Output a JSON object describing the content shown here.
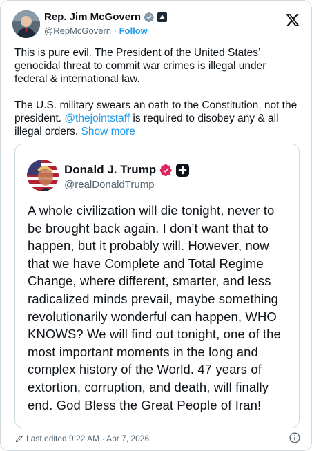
{
  "author": {
    "name": "Rep. Jim McGovern",
    "handle": "@RepMcGovern",
    "separator": "·",
    "follow_label": "Follow"
  },
  "tweet": {
    "paragraph1": "This is pure evil. The President of the United States’ genocidal threat to commit war crimes is illegal under federal & international law.",
    "paragraph2_before": "The U.S. military swears an oath to the Constitution, not the president. ",
    "mention": "@thejointstaff",
    "paragraph2_after": " is required to disobey any & all illegal orders. ",
    "show_more": "Show more"
  },
  "quote": {
    "name": "Donald J. Trump",
    "handle": "@realDonaldTrump",
    "text": "A whole civilization will die tonight, never to be brought back again. I don’t want that to happen, but it probably will. However, now that we have Complete and Total Regime Change, where different, smarter, and less radicalized minds prevail, maybe something revolutionarily wonderful can happen, WHO KNOWS? We will find out tonight, one of the most important moments in the long and complex history of the World. 47 years of extortion, corruption, and death, will finally end. God Bless the Great People of Iran!"
  },
  "footer": {
    "edited": "Last edited 9:22 AM · Apr 7, 2026"
  },
  "icons": {
    "verified": "gray-verified-badge-icon",
    "government": "government-label-icon",
    "x_logo": "x-logo-icon",
    "quote_verified": "pink-verified-badge-icon",
    "quote_label": "square-plus-badge-icon",
    "edit": "pencil-icon",
    "info": "info-icon"
  },
  "colors": {
    "link": "#1d9bf0",
    "text": "#0f1419",
    "secondary": "#536471",
    "border": "#cfd9de",
    "verified_gray": "#829aab",
    "verified_pink": "#e0245e"
  }
}
